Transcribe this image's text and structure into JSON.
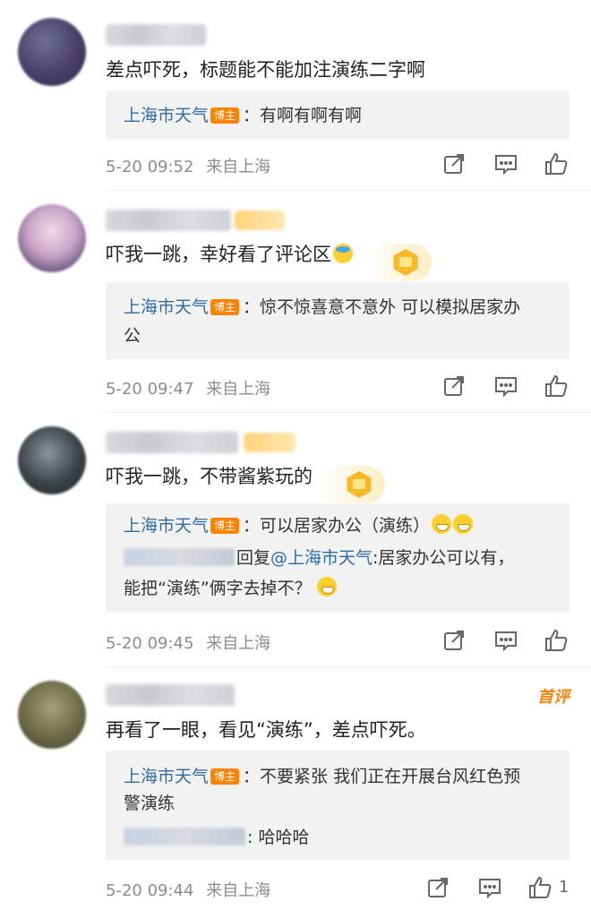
{
  "comments": [
    {
      "text": "差点吓死，标题能不能加注演练二字啊",
      "replies": [
        {
          "author": "上海市天气",
          "badge": "博主",
          "text": "：有啊有啊有啊"
        }
      ],
      "time": "5-20 09:52",
      "location": "来自上海"
    },
    {
      "text": "吓我一跳，幸好看了评论区",
      "replies": [
        {
          "author": "上海市天气",
          "badge": "博主",
          "text": "：惊不惊喜意不意外 可以模拟居家办",
          "text2": "公"
        }
      ],
      "time": "5-20 09:47",
      "location": "来自上海"
    },
    {
      "text": "吓我一跳，不带酱紫玩的",
      "replies": [
        {
          "author": "上海市天气",
          "badge": "博主",
          "text": "：可以居家办公（演练）"
        },
        {
          "prefix": "回复",
          "mention": "@上海市天气",
          "text": ":居家办公可以有，",
          "text2": "能把“演练”俩字去掉不？"
        }
      ],
      "time": "5-20 09:45",
      "location": "来自上海"
    },
    {
      "text": "再看了一眼，看见“演练”，差点吓死。",
      "first_badge": "首评",
      "replies": [
        {
          "author": "上海市天气",
          "badge": "博主",
          "text": "：不要紧张 我们正在开展台风红色预",
          "text2": "警演练"
        },
        {
          "text": ": 哈哈哈"
        }
      ],
      "time": "5-20 09:44",
      "location": "来自上海",
      "like_count": "1"
    }
  ],
  "icons": {
    "share": "share-icon",
    "comment": "comment-icon",
    "like": "thumbs-up-icon"
  },
  "colors": {
    "link_blue": "#2f6ca3",
    "badge_orange": "#ff8200",
    "reply_bg": "#f2f2f2",
    "meta_gray": "#8c8c8c"
  }
}
